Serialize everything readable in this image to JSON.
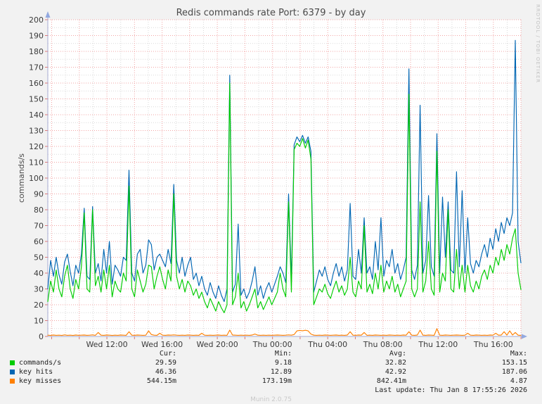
{
  "title": "Redis commands rate Port: 6379 - by day",
  "watermark": "RRDTOOL / TOBI OETIKER",
  "legend": {
    "headers": {
      "cur": "Cur:",
      "min": "Min:",
      "avg": "Avg:",
      "max": "Max:"
    },
    "rows": [
      {
        "label": "commands/s",
        "color": "#00CC00",
        "cur": "29.59",
        "min": "9.18",
        "avg": "32.82",
        "max": "153.15"
      },
      {
        "label": "key hits",
        "color": "#0066B3",
        "cur": "46.36",
        "min": "12.89",
        "avg": "42.92",
        "max": "187.06"
      },
      {
        "label": "key misses",
        "color": "#FF8000",
        "cur": "544.15m",
        "min": "173.19m",
        "avg": "842.41m",
        "max": "4.87"
      }
    ],
    "last_update": "Last update: Thu Jan  8 17:55:26 2026",
    "version": "Munin 2.0.75"
  },
  "colors": {
    "page_bg": "#f2f2f2",
    "plot_bg": "#ffffff",
    "grid_major": "#f2a4a4",
    "grid_minor": "#d9d9d9",
    "tick_mark": "#dd7777",
    "axis": "#a6aad2",
    "arrow": "#93a9e0",
    "tick_text": "#3a3a3a"
  },
  "chart_data": {
    "type": "line",
    "title": "Redis commands rate Port: 6379 - by day",
    "ylabel": "commands/s",
    "ylim": [
      0,
      200
    ],
    "ytick_step": 10,
    "grid": true,
    "legend_position": "bottom",
    "x_tick_labels": [
      "Wed 12:00",
      "Wed 16:00",
      "Wed 20:00",
      "Thu 00:00",
      "Thu 04:00",
      "Thu 08:00",
      "Thu 12:00",
      "Thu 16:00"
    ],
    "series": [
      {
        "name": "commands/s",
        "color": "#00CC00",
        "tuple_index": 0
      },
      {
        "name": "key hits",
        "color": "#0066B3",
        "tuple_index": 1
      },
      {
        "name": "key misses",
        "color": "#FF8000",
        "tuple_index": 2
      }
    ],
    "points_format": "[commands_per_s, key_hits, key_misses] sampled evenly from Wed ~07:40 to Thu ~17:55",
    "points": [
      [
        22,
        30,
        0.8
      ],
      [
        35,
        48,
        0.6
      ],
      [
        28,
        38,
        0.9
      ],
      [
        42,
        50,
        0.7
      ],
      [
        30,
        39,
        0.8
      ],
      [
        25,
        33,
        0.6
      ],
      [
        38,
        47,
        1.0
      ],
      [
        45,
        52,
        0.7
      ],
      [
        30,
        41,
        0.8
      ],
      [
        24,
        32,
        0.6
      ],
      [
        36,
        45,
        0.9
      ],
      [
        30,
        40,
        0.7
      ],
      [
        44,
        52,
        0.8
      ],
      [
        78,
        81,
        0.9
      ],
      [
        30,
        38,
        0.7
      ],
      [
        28,
        36,
        0.8
      ],
      [
        80,
        82,
        1.0
      ],
      [
        32,
        40,
        0.7
      ],
      [
        38,
        46,
        2.5
      ],
      [
        28,
        35,
        0.8
      ],
      [
        42,
        55,
        0.7
      ],
      [
        30,
        40,
        0.9
      ],
      [
        45,
        60,
        0.8
      ],
      [
        25,
        33,
        0.6
      ],
      [
        35,
        45,
        0.8
      ],
      [
        30,
        42,
        0.7
      ],
      [
        28,
        38,
        0.9
      ],
      [
        40,
        50,
        0.8
      ],
      [
        35,
        48,
        0.7
      ],
      [
        95,
        105,
        3.0
      ],
      [
        30,
        40,
        0.8
      ],
      [
        25,
        35,
        0.7
      ],
      [
        42,
        52,
        0.9
      ],
      [
        35,
        55,
        0.8
      ],
      [
        28,
        40,
        0.7
      ],
      [
        33,
        45,
        0.8
      ],
      [
        45,
        61,
        3.5
      ],
      [
        44,
        58,
        1.2
      ],
      [
        30,
        42,
        0.8
      ],
      [
        38,
        50,
        0.7
      ],
      [
        44,
        52,
        2.0
      ],
      [
        36,
        48,
        0.8
      ],
      [
        30,
        44,
        0.7
      ],
      [
        42,
        55,
        0.9
      ],
      [
        35,
        46,
        0.8
      ],
      [
        90,
        96,
        1.0
      ],
      [
        38,
        48,
        0.8
      ],
      [
        30,
        40,
        0.7
      ],
      [
        36,
        50,
        0.8
      ],
      [
        28,
        38,
        0.7
      ],
      [
        35,
        45,
        0.9
      ],
      [
        32,
        50,
        0.8
      ],
      [
        26,
        36,
        0.7
      ],
      [
        30,
        40,
        0.8
      ],
      [
        24,
        32,
        0.7
      ],
      [
        28,
        38,
        2.0
      ],
      [
        22,
        30,
        0.8
      ],
      [
        18,
        26,
        0.7
      ],
      [
        24,
        34,
        0.8
      ],
      [
        20,
        28,
        0.7
      ],
      [
        16,
        24,
        0.8
      ],
      [
        22,
        32,
        0.9
      ],
      [
        18,
        26,
        0.7
      ],
      [
        15,
        22,
        0.8
      ],
      [
        20,
        30,
        0.7
      ],
      [
        160,
        165,
        4.0
      ],
      [
        20,
        28,
        0.9
      ],
      [
        25,
        33,
        0.8
      ],
      [
        40,
        71,
        0.7
      ],
      [
        18,
        26,
        0.8
      ],
      [
        22,
        30,
        0.7
      ],
      [
        16,
        24,
        0.8
      ],
      [
        20,
        28,
        0.7
      ],
      [
        25,
        35,
        0.9
      ],
      [
        30,
        44,
        1.5
      ],
      [
        18,
        26,
        0.8
      ],
      [
        22,
        32,
        0.7
      ],
      [
        17,
        24,
        0.8
      ],
      [
        21,
        30,
        0.7
      ],
      [
        25,
        34,
        0.8
      ],
      [
        20,
        28,
        0.7
      ],
      [
        24,
        33,
        0.8
      ],
      [
        28,
        38,
        0.9
      ],
      [
        40,
        44,
        0.8
      ],
      [
        30,
        40,
        0.7
      ],
      [
        25,
        34,
        0.8
      ],
      [
        85,
        90,
        1.0
      ],
      [
        28,
        36,
        0.8
      ],
      [
        118,
        121,
        1.2
      ],
      [
        122,
        126,
        3.5
      ],
      [
        120,
        123,
        3.8
      ],
      [
        125,
        127,
        3.6
      ],
      [
        119,
        122,
        3.9
      ],
      [
        124,
        126,
        3.5
      ],
      [
        112,
        117,
        1.5
      ],
      [
        20,
        28,
        0.8
      ],
      [
        25,
        35,
        0.7
      ],
      [
        30,
        42,
        0.8
      ],
      [
        28,
        38,
        0.7
      ],
      [
        33,
        44,
        0.9
      ],
      [
        27,
        36,
        0.8
      ],
      [
        24,
        32,
        0.7
      ],
      [
        30,
        40,
        0.8
      ],
      [
        35,
        46,
        0.9
      ],
      [
        28,
        38,
        0.7
      ],
      [
        32,
        44,
        0.8
      ],
      [
        26,
        35,
        0.7
      ],
      [
        30,
        42,
        0.9
      ],
      [
        50,
        84,
        3.0
      ],
      [
        28,
        38,
        0.8
      ],
      [
        25,
        36,
        0.7
      ],
      [
        35,
        55,
        0.9
      ],
      [
        30,
        40,
        0.8
      ],
      [
        70,
        75,
        2.5
      ],
      [
        28,
        40,
        0.7
      ],
      [
        33,
        44,
        0.8
      ],
      [
        27,
        36,
        0.7
      ],
      [
        40,
        60,
        0.9
      ],
      [
        30,
        42,
        0.8
      ],
      [
        45,
        75,
        0.7
      ],
      [
        28,
        38,
        0.8
      ],
      [
        35,
        48,
        0.7
      ],
      [
        30,
        44,
        0.9
      ],
      [
        38,
        55,
        0.8
      ],
      [
        28,
        40,
        0.7
      ],
      [
        33,
        46,
        0.8
      ],
      [
        25,
        36,
        0.7
      ],
      [
        30,
        42,
        0.9
      ],
      [
        35,
        50,
        0.8
      ],
      [
        153,
        169,
        3.0
      ],
      [
        30,
        42,
        0.8
      ],
      [
        25,
        36,
        0.7
      ],
      [
        30,
        45,
        0.9
      ],
      [
        85,
        146,
        4.0
      ],
      [
        28,
        40,
        0.8
      ],
      [
        35,
        48,
        0.7
      ],
      [
        60,
        89,
        0.9
      ],
      [
        30,
        44,
        0.8
      ],
      [
        26,
        38,
        0.7
      ],
      [
        117,
        128,
        4.87
      ],
      [
        28,
        40,
        0.8
      ],
      [
        40,
        88,
        0.7
      ],
      [
        35,
        50,
        0.9
      ],
      [
        80,
        85,
        0.8
      ],
      [
        30,
        42,
        0.7
      ],
      [
        28,
        40,
        0.8
      ],
      [
        55,
        104,
        0.9
      ],
      [
        30,
        44,
        0.8
      ],
      [
        45,
        92,
        0.7
      ],
      [
        28,
        40,
        0.8
      ],
      [
        45,
        75,
        2.0
      ],
      [
        32,
        46,
        0.8
      ],
      [
        28,
        40,
        0.7
      ],
      [
        35,
        48,
        0.9
      ],
      [
        30,
        44,
        0.8
      ],
      [
        38,
        52,
        0.7
      ],
      [
        42,
        58,
        0.8
      ],
      [
        36,
        50,
        0.7
      ],
      [
        45,
        62,
        0.9
      ],
      [
        40,
        55,
        0.8
      ],
      [
        50,
        68,
        2.0
      ],
      [
        45,
        60,
        0.8
      ],
      [
        55,
        72,
        0.9
      ],
      [
        48,
        65,
        3.0
      ],
      [
        58,
        75,
        0.8
      ],
      [
        52,
        70,
        3.5
      ],
      [
        62,
        78,
        0.9
      ],
      [
        68,
        187,
        2.5
      ],
      [
        40,
        60,
        0.8
      ],
      [
        29.6,
        46.4,
        0.6
      ]
    ]
  }
}
